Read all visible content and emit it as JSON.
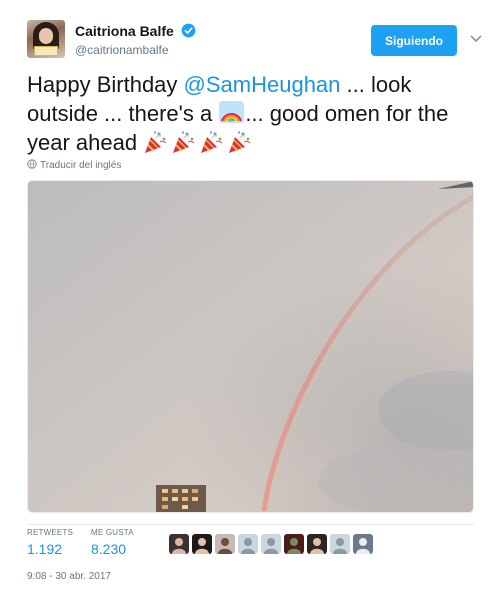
{
  "author": {
    "display_name": "Caitriona Balfe",
    "handle": "@caitrionambalfe",
    "verified": true,
    "avatar_icon": "profile-photo"
  },
  "follow_button": {
    "label": "Siguiendo",
    "color": "#1da1f2"
  },
  "tweet": {
    "text_1": "Happy Birthday ",
    "mention": "@SamHeughan",
    "text_2": " ... look outside ... there's a ",
    "emoji_rainbow": "rainbow-emoji",
    "text_3": "... good omen for the year ahead ",
    "emoji_party_count": 4,
    "emoji_party": "party-popper-emoji"
  },
  "translate": {
    "label": "Traducir del inglés",
    "icon": "globe-icon"
  },
  "media": {
    "description_icon": "rainbow-sky-photo"
  },
  "stats": {
    "retweets_label": "RETWEETS",
    "retweets_count": "1.192",
    "likes_label": "ME GUSTA",
    "likes_count": "8.230",
    "liker_avatars": [
      {
        "name": "liker-avatar-1",
        "bg": "#3b3230",
        "fg": "#d9b9a6"
      },
      {
        "name": "liker-avatar-2",
        "bg": "#1e1a1a",
        "fg": "#e4c2a9"
      },
      {
        "name": "liker-avatar-3",
        "bg": "#c7b9b4",
        "fg": "#6d4b3f"
      },
      {
        "name": "liker-avatar-4",
        "bg": "#ccd6dd",
        "fg": "#8899a6"
      },
      {
        "name": "liker-avatar-5",
        "bg": "#ccd6dd",
        "fg": "#8899a6"
      },
      {
        "name": "liker-avatar-6",
        "bg": "#4a1c1c",
        "fg": "#7a8b5a"
      },
      {
        "name": "liker-avatar-7",
        "bg": "#2b2623",
        "fg": "#e2c1a6"
      },
      {
        "name": "liker-avatar-8",
        "bg": "#ccd6dd",
        "fg": "#8899a6"
      },
      {
        "name": "liker-avatar-9",
        "bg": "#6b7a8a",
        "fg": "#e7edf3"
      }
    ]
  },
  "timestamp": "9:08 - 30 abr. 2017",
  "colors": {
    "link": "#1b95e0",
    "muted": "#657786",
    "text": "#14171a",
    "divider": "#e6ecf0"
  }
}
